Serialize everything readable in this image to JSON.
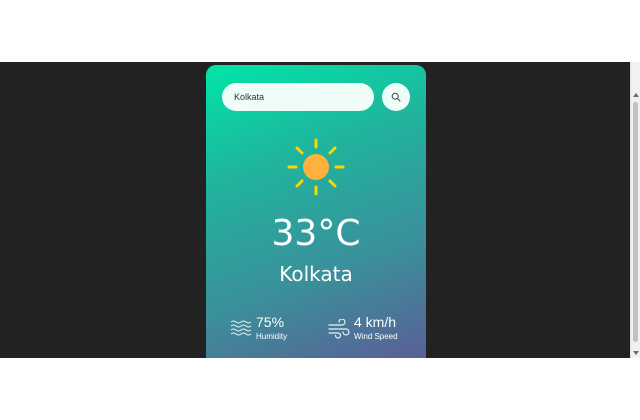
{
  "colors": {
    "page_background": "#ffffff",
    "viewport_background": "#222222",
    "card_gradient_start": "#00e6a8",
    "card_gradient_end": "#5a5f96",
    "sun_core": "#ffb13d",
    "sun_rays": "#ffd400",
    "text": "#ffffff"
  },
  "search": {
    "value": "Kolkata",
    "button_icon": "search-icon"
  },
  "weather": {
    "icon": "sun-icon",
    "temperature": "33°C",
    "city": "Kolkata"
  },
  "details": {
    "humidity": {
      "icon": "humidity-waves-icon",
      "value": "75%",
      "label": "Humidity"
    },
    "wind": {
      "icon": "wind-icon",
      "value": "4 km/h",
      "label": "Wind Speed"
    }
  }
}
